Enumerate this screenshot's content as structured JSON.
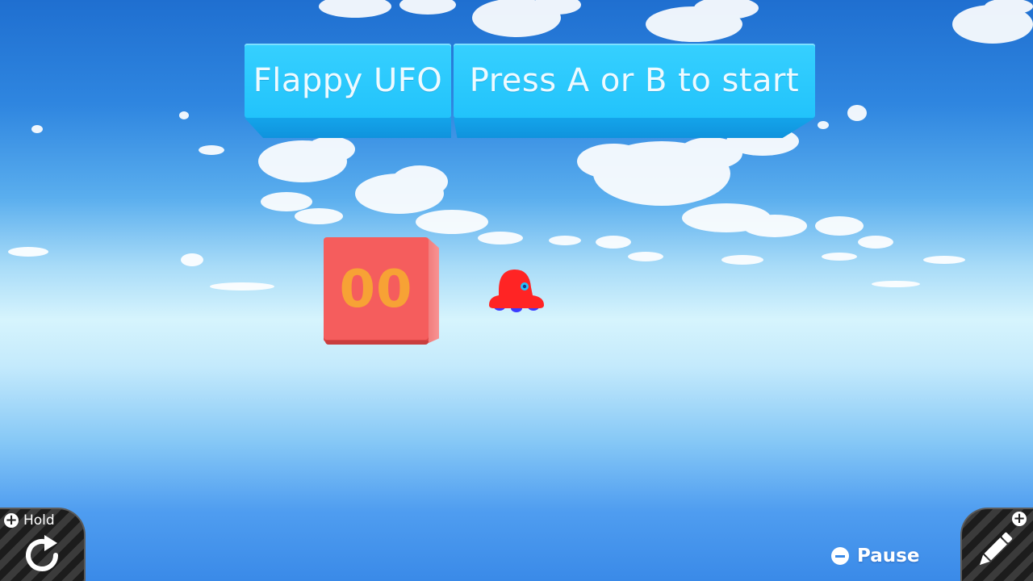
{
  "game": {
    "title": "Flappy UFO",
    "prompt": "Press A or B to start",
    "score": "00"
  },
  "controls": {
    "hold_label": "Hold",
    "pause_label": "Pause",
    "hold_icon": "restart-icon",
    "edit_icon": "pencil-icon",
    "plus_glyph": "+"
  },
  "colors": {
    "panel": "#22c3fb",
    "score_cube": "#f55d5d",
    "score_digits": "#f7a235",
    "ufo_body": "#ff2424",
    "ufo_lights": "#3b3bff",
    "ufo_eye": "#22c3fb"
  }
}
